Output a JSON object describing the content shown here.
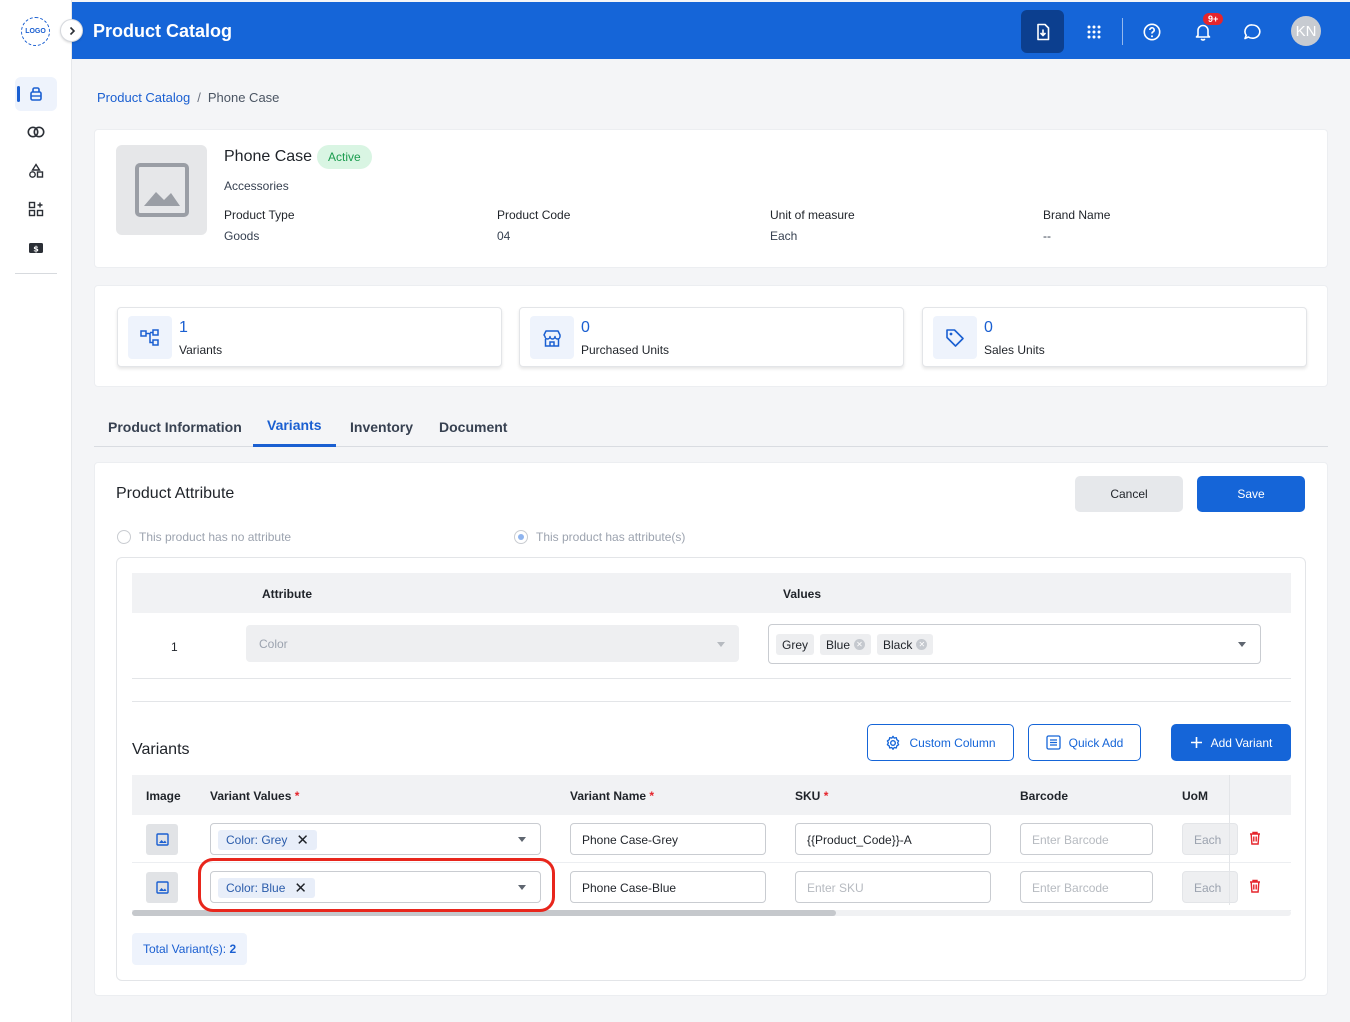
{
  "sidebar": {
    "logo_text": "LOGO",
    "items": [
      {
        "icon": "inventory-box-icon",
        "active": true
      },
      {
        "icon": "rings-icon",
        "active": false
      },
      {
        "icon": "shapes-icon",
        "active": false
      },
      {
        "icon": "apps-grid-icon",
        "active": false
      },
      {
        "icon": "money-icon",
        "active": false
      }
    ]
  },
  "header": {
    "title": "Product Catalog",
    "notification_count": "9+",
    "avatar_initials": "KN",
    "brand_color": "#1565d8"
  },
  "breadcrumb": {
    "parent": "Product Catalog",
    "separator": "/",
    "current": "Phone Case"
  },
  "product": {
    "name": "Phone Case",
    "status": "Active",
    "category": "Accessories",
    "meta": [
      {
        "label": "Product Type",
        "value": "Goods"
      },
      {
        "label": "Product Code",
        "value": "04"
      },
      {
        "label": "Unit of measure",
        "value": "Each"
      },
      {
        "label": "Brand Name",
        "value": "--"
      }
    ]
  },
  "stats": [
    {
      "value": "1",
      "label": "Variants",
      "icon": "hierarchy-icon"
    },
    {
      "value": "0",
      "label": "Purchased Units",
      "icon": "store-icon"
    },
    {
      "value": "0",
      "label": "Sales Units",
      "icon": "tag-icon"
    }
  ],
  "tabs": [
    "Product Information",
    "Variants",
    "Inventory",
    "Document"
  ],
  "active_tab": "Variants",
  "attribute_section": {
    "title": "Product Attribute",
    "cancel_label": "Cancel",
    "save_label": "Save",
    "radio_no_attr": "This product has no attribute",
    "radio_has_attr": "This product has attribute(s)",
    "selected_radio": "has",
    "columns": [
      "Attribute",
      "Values"
    ],
    "rows": [
      {
        "index": "1",
        "attribute": "Color",
        "values": [
          "Grey",
          "Blue",
          "Black"
        ]
      }
    ]
  },
  "variants_section": {
    "title": "Variants",
    "custom_column_label": "Custom Column",
    "quick_add_label": "Quick Add",
    "add_variant_label": "Add Variant",
    "columns": {
      "image": "Image",
      "variant_values": "Variant Values",
      "variant_name": "Variant Name",
      "sku": "SKU",
      "barcode": "Barcode",
      "uom": "UoM"
    },
    "rows": [
      {
        "value_chip": "Color: Grey",
        "name": "Phone Case-Grey",
        "sku": "{{Product_Code}}-A",
        "sku_placeholder": "Enter SKU",
        "barcode_placeholder": "Enter Barcode",
        "uom": "Each"
      },
      {
        "value_chip": "Color: Blue",
        "name": "Phone Case-Blue",
        "sku": "",
        "sku_placeholder": "Enter SKU",
        "barcode_placeholder": "Enter Barcode",
        "uom": "Each"
      }
    ],
    "total_label": "Total Variant(s):",
    "total_count": "2"
  }
}
